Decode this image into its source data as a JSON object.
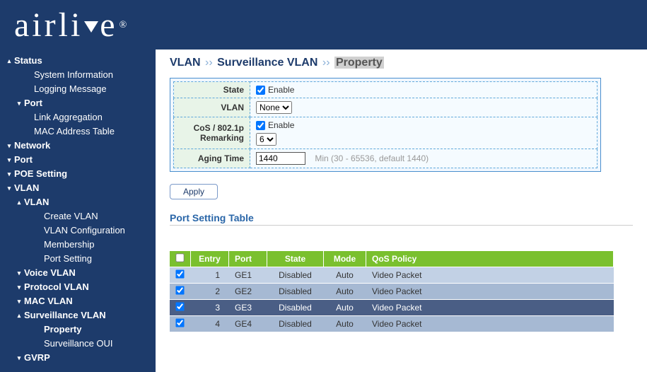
{
  "app": {
    "logo_left": "airli",
    "logo_right": "e",
    "reg": "®"
  },
  "breadcrumb": {
    "a": "VLAN",
    "sep": "››",
    "b": "Surveillance VLAN",
    "c": "Property"
  },
  "config": {
    "labels": {
      "state": "State",
      "vlan": "VLAN",
      "cos_l1": "CoS / 802.1p",
      "cos_l2": "Remarking",
      "aging": "Aging Time"
    },
    "state_enable_label": "Enable",
    "state_checked": true,
    "vlan_selected": "None",
    "cos_enable_label": "Enable",
    "cos_checked": true,
    "cos_value": "6",
    "aging_value": "1440",
    "aging_hint": "Min (30 - 65536, default 1440)"
  },
  "buttons": {
    "apply": "Apply"
  },
  "section_title": "Port Setting Table",
  "table": {
    "headers": {
      "entry": "Entry",
      "port": "Port",
      "state": "State",
      "mode": "Mode",
      "qos": "QoS Policy"
    },
    "rows": [
      {
        "checked": true,
        "entry": "1",
        "port": "GE1",
        "state": "Disabled",
        "mode": "Auto",
        "qos": "Video Packet",
        "selected": false
      },
      {
        "checked": true,
        "entry": "2",
        "port": "GE2",
        "state": "Disabled",
        "mode": "Auto",
        "qos": "Video Packet",
        "selected": false
      },
      {
        "checked": true,
        "entry": "3",
        "port": "GE3",
        "state": "Disabled",
        "mode": "Auto",
        "qos": "Video Packet",
        "selected": true
      },
      {
        "checked": true,
        "entry": "4",
        "port": "GE4",
        "state": "Disabled",
        "mode": "Auto",
        "qos": "Video Packet",
        "selected": false
      }
    ]
  },
  "sidebar": [
    {
      "lvl": "lvl0",
      "caret": "up",
      "label": "Status"
    },
    {
      "lvl": "lvl1n",
      "caret": "",
      "label": "System Information"
    },
    {
      "lvl": "lvl1n",
      "caret": "",
      "label": "Logging Message"
    },
    {
      "lvl": "lvl1",
      "caret": "down",
      "label": "Port"
    },
    {
      "lvl": "lvl1n",
      "caret": "",
      "label": "Link Aggregation"
    },
    {
      "lvl": "lvl1n",
      "caret": "",
      "label": "MAC Address Table"
    },
    {
      "lvl": "lvl0",
      "caret": "down",
      "label": "Network"
    },
    {
      "lvl": "lvl0",
      "caret": "down",
      "label": "Port"
    },
    {
      "lvl": "lvl0",
      "caret": "down",
      "label": "POE Setting"
    },
    {
      "lvl": "lvl0",
      "caret": "down",
      "label": "VLAN"
    },
    {
      "lvl": "lvl1",
      "caret": "up",
      "label": "VLAN"
    },
    {
      "lvl": "lvl2n",
      "caret": "",
      "label": "Create VLAN"
    },
    {
      "lvl": "lvl2n",
      "caret": "",
      "label": "VLAN Configuration"
    },
    {
      "lvl": "lvl2n",
      "caret": "",
      "label": "Membership"
    },
    {
      "lvl": "lvl2n",
      "caret": "",
      "label": "Port Setting"
    },
    {
      "lvl": "lvl1",
      "caret": "down",
      "label": "Voice VLAN"
    },
    {
      "lvl": "lvl1",
      "caret": "down",
      "label": "Protocol VLAN"
    },
    {
      "lvl": "lvl1",
      "caret": "down",
      "label": "MAC VLAN"
    },
    {
      "lvl": "lvl1",
      "caret": "up",
      "label": "Surveillance VLAN"
    },
    {
      "lvl": "lvl2n",
      "caret": "",
      "label": "Property",
      "active": true
    },
    {
      "lvl": "lvl2n",
      "caret": "",
      "label": "Surveillance OUI"
    },
    {
      "lvl": "lvl1",
      "caret": "down",
      "label": "GVRP"
    }
  ]
}
